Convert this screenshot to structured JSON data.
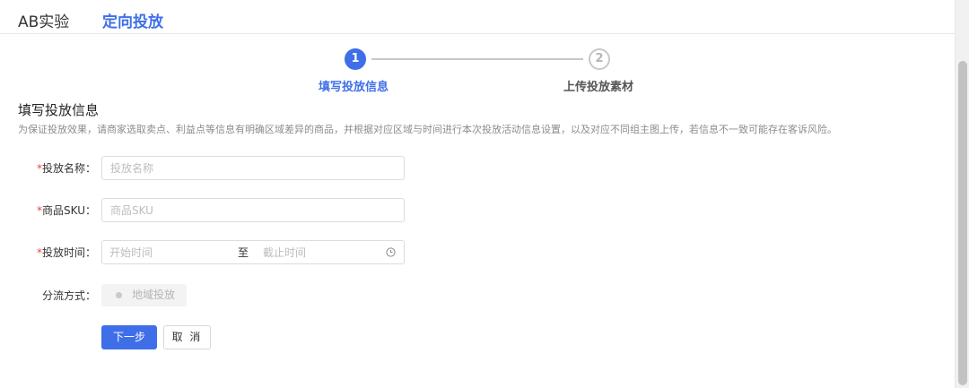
{
  "tabs": [
    {
      "label": "AB实验",
      "active": false
    },
    {
      "label": "定向投放",
      "active": true
    }
  ],
  "steps": [
    {
      "number": "1",
      "label": "填写投放信息",
      "active": true
    },
    {
      "number": "2",
      "label": "上传投放素材",
      "active": false
    }
  ],
  "section": {
    "title": "填写投放信息",
    "description": "为保证投放效果，请商家选取卖点、利益点等信息有明确区域差异的商品，并根据对应区域与时间进行本次投放活动信息设置，以及对应不同组主图上传，若信息不一致可能存在客诉风险。"
  },
  "form": {
    "required_mark": "*",
    "name": {
      "label": "投放名称：",
      "placeholder": "投放名称",
      "value": ""
    },
    "sku": {
      "label": "商品SKU：",
      "placeholder": "商品SKU",
      "value": ""
    },
    "time": {
      "label": "投放时间：",
      "start_placeholder": "开始时间",
      "separator": "至",
      "end_placeholder": "截止时间"
    },
    "split": {
      "label": "分流方式：",
      "option": "地域投放",
      "disabled": true
    }
  },
  "buttons": {
    "next": "下一步",
    "cancel": "取 消"
  },
  "colors": {
    "primary": "#3f6fe8",
    "required": "#e64545",
    "muted": "#8c8c8c"
  },
  "icons": {
    "time_suffix": "clock-icon"
  }
}
